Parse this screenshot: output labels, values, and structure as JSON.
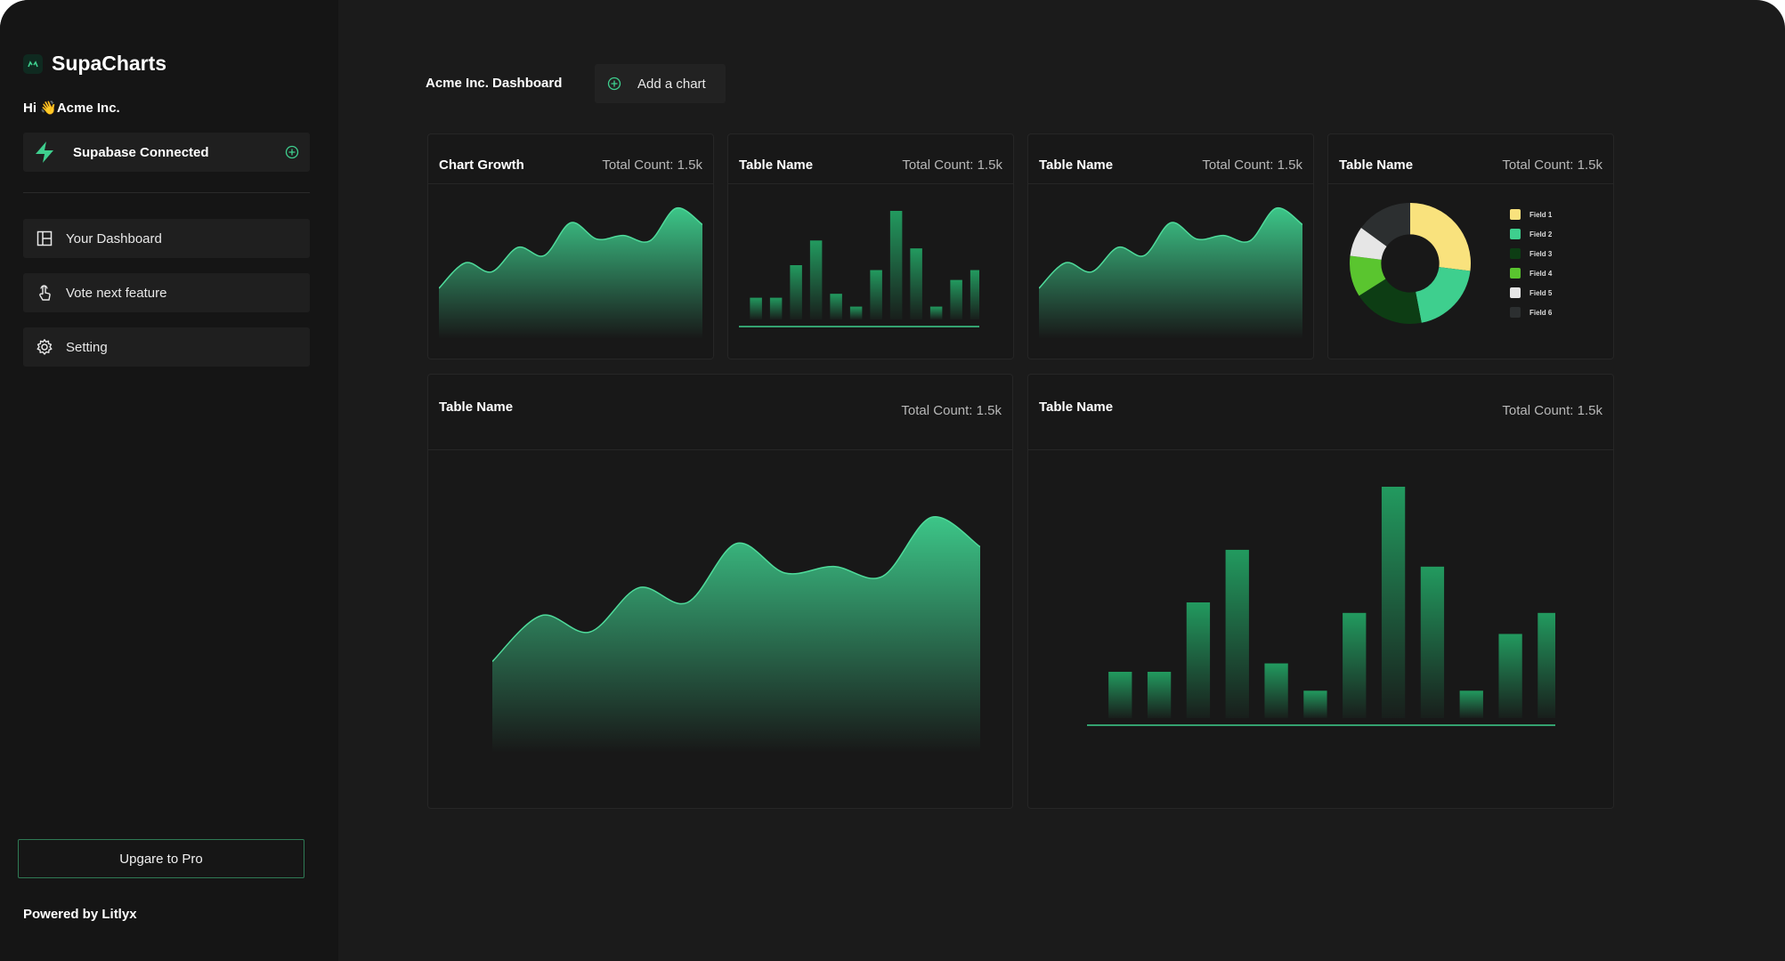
{
  "app": {
    "name": "SupaCharts"
  },
  "sidebar": {
    "greeting": "Hi 👋Acme Inc.",
    "connection": {
      "label": "Supabase Connected"
    },
    "nav": [
      {
        "label": "Your Dashboard",
        "icon": "dashboard-icon"
      },
      {
        "label": "Vote next feature",
        "icon": "pointer-hand-icon"
      },
      {
        "label": "Setting",
        "icon": "gear-icon"
      }
    ],
    "upgrade_label": "Upgare to Pro",
    "footer": "Powered by Litlyx"
  },
  "main": {
    "title": "Acme Inc. Dashboard",
    "add_chart_label": "Add a chart"
  },
  "colors": {
    "accent": "#3ecf8e",
    "bar_top": "#229a5f",
    "pie": [
      "#f9e27d",
      "#3ecf8e",
      "#0d3d14",
      "#5ac52f",
      "#e6e6e6",
      "#2c2f30"
    ]
  },
  "cards": [
    {
      "title": "Chart Growth",
      "count": "Total Count: 1.5k"
    },
    {
      "title": "Table Name",
      "count": "Total Count: 1.5k"
    },
    {
      "title": "Table Name",
      "count": "Total Count: 1.5k"
    },
    {
      "title": "Table Name",
      "count": "Total Count: 1.5k"
    },
    {
      "title": "Table Name",
      "count": "Total Count: 1.5k"
    },
    {
      "title": "Table Name",
      "count": "Total Count: 1.5k"
    }
  ],
  "chart_data": [
    {
      "type": "area",
      "values": [
        0,
        28,
        18,
        45,
        36,
        72,
        54,
        58,
        52,
        88,
        70
      ]
    },
    {
      "type": "bar",
      "values": [
        22,
        22,
        55,
        80,
        26,
        13,
        50,
        110,
        72,
        13,
        40,
        50
      ]
    },
    {
      "type": "area",
      "values": [
        0,
        28,
        18,
        45,
        36,
        72,
        54,
        58,
        52,
        88,
        70
      ]
    },
    {
      "type": "pie",
      "labels": [
        "Field 1",
        "Field 2",
        "Field 3",
        "Field 4",
        "Field 5",
        "Field 6"
      ],
      "values": [
        27,
        20,
        19,
        11,
        8,
        15
      ]
    },
    {
      "type": "area",
      "values": [
        0,
        28,
        18,
        45,
        36,
        72,
        54,
        58,
        52,
        88,
        70
      ]
    },
    {
      "type": "bar",
      "values": [
        22,
        22,
        55,
        80,
        26,
        13,
        50,
        110,
        72,
        13,
        40,
        50
      ]
    }
  ]
}
